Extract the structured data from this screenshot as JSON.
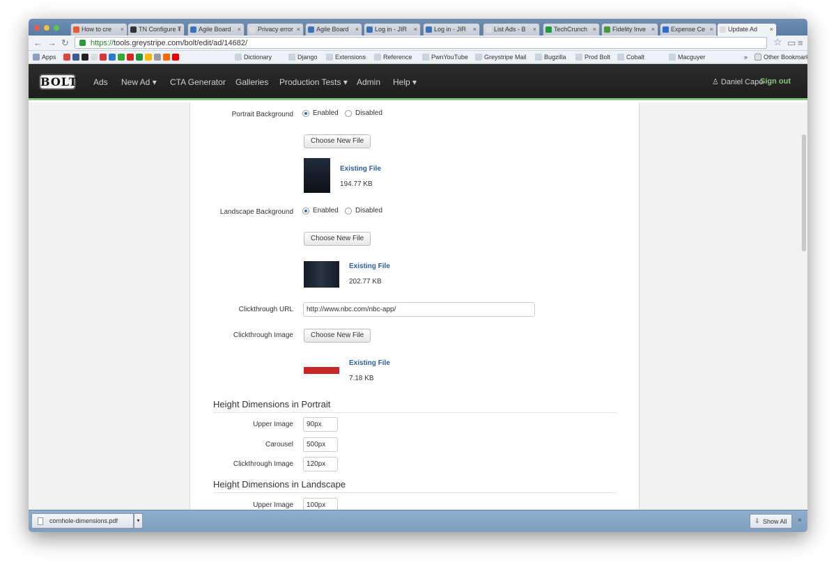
{
  "browser": {
    "tabs": [
      {
        "label": "How to cre",
        "color": "#e55b2b"
      },
      {
        "label": "TN Configure T",
        "color": "#333333"
      },
      {
        "label": "Agile Board",
        "color": "#3b73b9"
      },
      {
        "label": "Privacy error",
        "color": "#dddddd"
      },
      {
        "label": "Agile Board",
        "color": "#3b73b9"
      },
      {
        "label": "Log in - JIR",
        "color": "#3b73b9"
      },
      {
        "label": "Log in - JIR",
        "color": "#3b73b9"
      },
      {
        "label": "List Ads - B",
        "color": "#dddddd"
      },
      {
        "label": "TechCrunch",
        "color": "#1a9a3a"
      },
      {
        "label": "Fidelity Inve",
        "color": "#4a9a3a"
      },
      {
        "label": "Expense Ce",
        "color": "#2d6bd1"
      },
      {
        "label": "Update Ad",
        "color": "#dddddd"
      }
    ],
    "url_scheme": "https://",
    "url_rest": "tools.greystripe.com/bolt/edit/ad/14682/",
    "bookmarks": {
      "apps": "Apps",
      "items": [
        "Dictionary",
        "Django",
        "Extensions",
        "Reference",
        "PwnYouTube",
        "Greystripe Mail",
        "Bugzilla",
        "Prod Bolt",
        "Cobalt",
        "Macguyer"
      ],
      "other": "Other Bookmarks"
    }
  },
  "app": {
    "logo": "BOLT",
    "nav": [
      "Ads",
      "New Ad ▾",
      "CTA Generator",
      "Galleries",
      "Production Tests ▾",
      "Admin",
      "Help ▾"
    ],
    "user": "Daniel Capo",
    "signout": "Sign out"
  },
  "form": {
    "portrait_bg": {
      "label": "Portrait Background",
      "enabled": "Enabled",
      "disabled": "Disabled",
      "choose": "Choose New File",
      "existing": "Existing File",
      "size": "194.77 KB"
    },
    "landscape_bg": {
      "label": "Landscape Background",
      "enabled": "Enabled",
      "disabled": "Disabled",
      "choose": "Choose New File",
      "existing": "Existing File",
      "size": "202.77 KB"
    },
    "clickthrough_url": {
      "label": "Clickthrough URL",
      "value": "http://www.nbc.com/nbc-app/"
    },
    "clickthrough_image": {
      "label": "Clickthrough Image",
      "choose": "Choose New File",
      "existing": "Existing File",
      "size": "7.18 KB"
    },
    "portrait_heights": {
      "title": "Height Dimensions in Portrait",
      "upper_label": "Upper Image",
      "upper": "90px",
      "carousel_label": "Carousel",
      "carousel": "500px",
      "click_label": "Clickthrough Image",
      "click": "120px"
    },
    "landscape_heights": {
      "title": "Height Dimensions in Landscape",
      "upper_label": "Upper Image",
      "upper": "100px"
    }
  },
  "downloads": {
    "file": "cornhole-dimensions.pdf",
    "show_all": "Show All"
  }
}
